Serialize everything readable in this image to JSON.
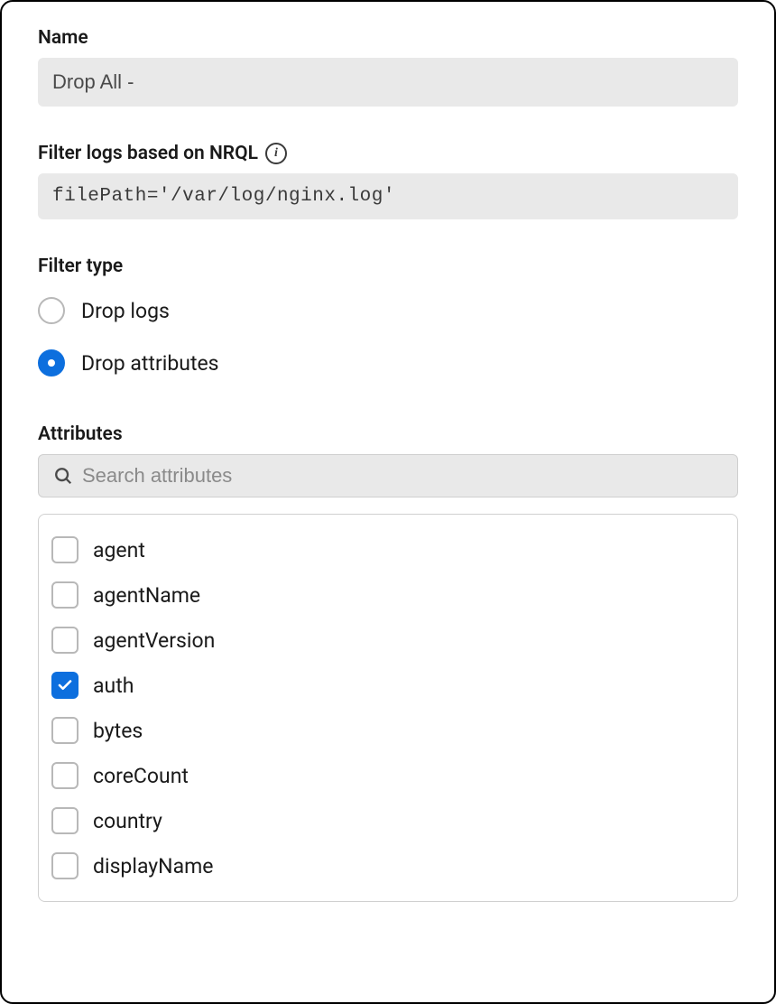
{
  "name_field": {
    "label": "Name",
    "value": "Drop All -"
  },
  "nrql_field": {
    "label": "Filter logs based on NRQL",
    "value": "filePath='/var/log/nginx.log'"
  },
  "filter_type": {
    "label": "Filter type",
    "options": [
      {
        "label": "Drop logs",
        "selected": false
      },
      {
        "label": "Drop attributes",
        "selected": true
      }
    ]
  },
  "attributes": {
    "label": "Attributes",
    "search_placeholder": "Search attributes",
    "items": [
      {
        "label": "agent",
        "checked": false
      },
      {
        "label": "agentName",
        "checked": false
      },
      {
        "label": "agentVersion",
        "checked": false
      },
      {
        "label": "auth",
        "checked": true
      },
      {
        "label": "bytes",
        "checked": false
      },
      {
        "label": "coreCount",
        "checked": false
      },
      {
        "label": "country",
        "checked": false
      },
      {
        "label": "displayName",
        "checked": false
      }
    ]
  }
}
